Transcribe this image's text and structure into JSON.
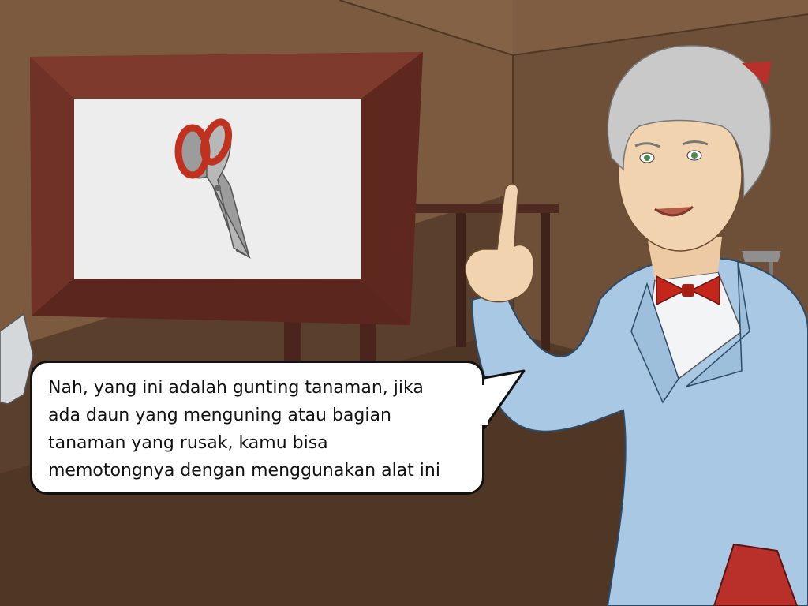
{
  "dialog": {
    "text": "Nah, yang ini adalah gunting tanaman, jika\nada daun yang menguning atau bagian\ntanaman yang rusak, kamu bisa\nmemotongnya dengan menggunakan alat ini"
  },
  "scene": {
    "setting": "wooden-classroom",
    "board_item": "pruning-scissors",
    "character": "elderly-teacher",
    "colors": {
      "wall": "#7b5a3f",
      "floor": "#5a3f2c",
      "frame": "#6b2f24",
      "board": "#ededed",
      "scissor_handle": "#c0321f",
      "coat": "#a9c8e4",
      "bowtie": "#c4261c",
      "hair": "#c9c9c9",
      "skin": "#f2d3b0",
      "book": "#b9302a"
    }
  }
}
